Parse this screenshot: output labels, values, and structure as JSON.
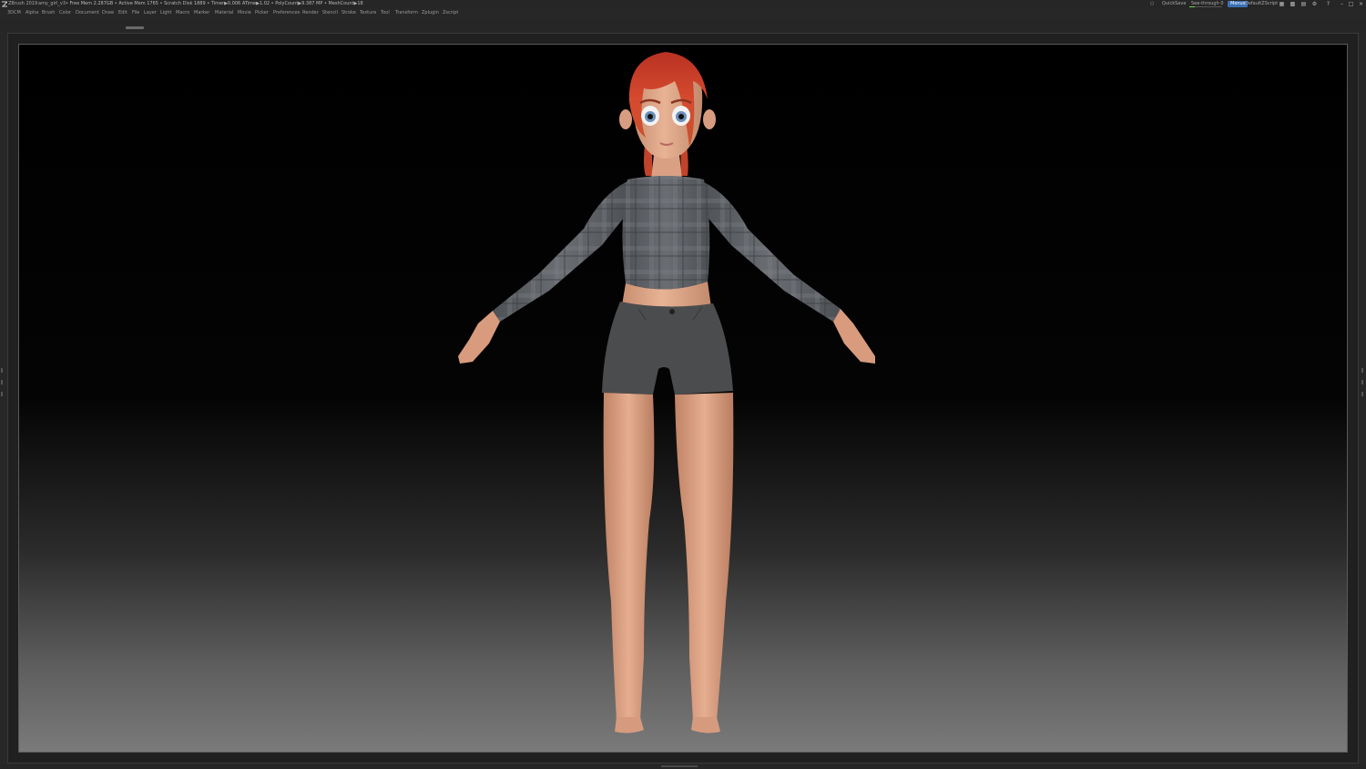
{
  "titlebar": {
    "app_title": "ZBrush 2019",
    "file_name": "amy_girl_v3",
    "stats": "• Free Mem 2.287GB • Active Mem 1765 • Scratch Disk 1889 • Timer▶0.006 ATime▶1.02 • PolyCount▶9.387 MP • MeshCount▶18",
    "quicksave": "QuickSave",
    "seethrough": "See-through  0",
    "menus": "Menus",
    "default_script": "DefaultZScript"
  },
  "menubar": {
    "items": [
      "3DCM",
      "Alpha",
      "Brush",
      "Color",
      "Document",
      "Draw",
      "Edit",
      "File",
      "Layer",
      "Light",
      "Macro",
      "Marker",
      "Material",
      "Movie",
      "Picker",
      "Preferences",
      "Render",
      "Stencil",
      "Stroke",
      "Texture",
      "Tool",
      "Transform",
      "Zplugin",
      "Zscript"
    ]
  },
  "colors": {
    "ui_bg": "#272727",
    "accent": "#3a6fb5",
    "skin": "#e0a988",
    "hair": "#c8402a",
    "shirt": "#5f6267",
    "shorts": "#4b4c4e"
  },
  "icons": {
    "logo": "zbrush-logo-icon",
    "window": [
      "layout-icon",
      "palette-icon",
      "help-icon",
      "minimize-icon",
      "restore-icon",
      "close-icon"
    ]
  }
}
